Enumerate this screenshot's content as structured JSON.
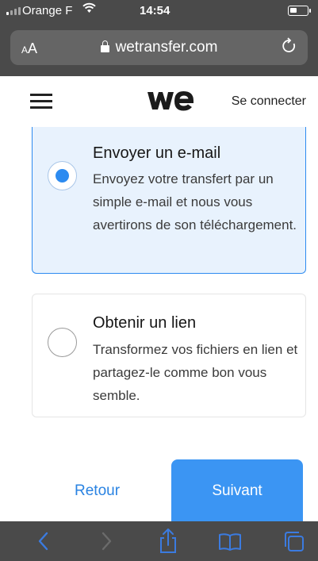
{
  "status_bar": {
    "carrier": "Orange F",
    "time": "14:54"
  },
  "browser": {
    "text_size_label_small": "A",
    "text_size_label_large": "A",
    "url": "wetransfer.com"
  },
  "header": {
    "login_label": "Se connecter"
  },
  "options": [
    {
      "title": "Envoyer un e-mail",
      "description": "Envoyez votre transfert par un simple e-mail et nous vous avertirons de son téléchargement.",
      "selected": true
    },
    {
      "title": "Obtenir un lien",
      "description": "Transformez vos fichiers en lien et partagez-le comme bon vous semble.",
      "selected": false
    }
  ],
  "actions": {
    "back_label": "Retour",
    "next_label": "Suivant"
  },
  "colors": {
    "accent": "#3b95f3",
    "selected_card_bg": "#e8f2fd",
    "chrome_bg": "#4a4a4a",
    "toolbar_icon": "#3b7be0"
  },
  "icons": {
    "toolbar": [
      "back-icon",
      "forward-icon",
      "share-icon",
      "bookmarks-icon",
      "tabs-icon"
    ]
  }
}
